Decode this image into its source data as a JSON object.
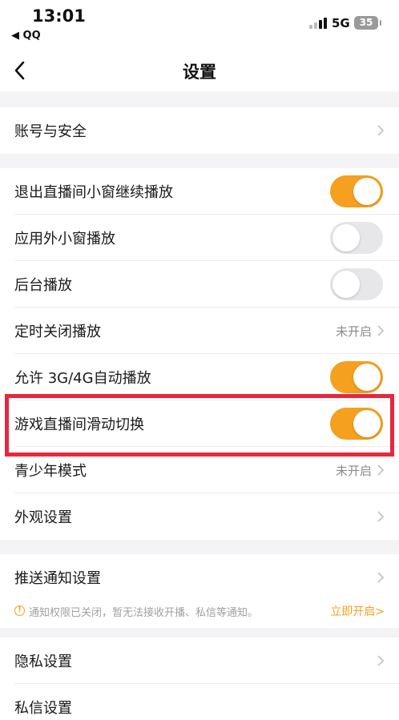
{
  "status_bar": {
    "time": "13:01",
    "back_app": "◀ QQ",
    "network": "5G",
    "battery": "35"
  },
  "nav": {
    "title": "设置"
  },
  "groups": {
    "account": {
      "label": "账号与安全"
    },
    "playback": [
      {
        "label": "退出直播间小窗继续播放",
        "toggle": true
      },
      {
        "label": "应用外小窗播放",
        "toggle": false
      },
      {
        "label": "后台播放",
        "toggle": false
      },
      {
        "label": "定时关闭播放",
        "value": "未开启"
      },
      {
        "label": "允许 3G/4G自动播放",
        "toggle": true
      },
      {
        "label": "游戏直播间滑动切换",
        "toggle": true
      },
      {
        "label": "青少年模式",
        "value": "未开启"
      },
      {
        "label": "外观设置"
      }
    ],
    "notify": {
      "label": "推送通知设置",
      "notice_text": "通知权限已关闭，暂无法接收开播、私信等通知。",
      "notice_action": "立即开启>"
    },
    "privacy": [
      {
        "label": "隐私设置"
      },
      {
        "label": "私信设置"
      }
    ]
  },
  "colors": {
    "accent": "#f5a01e",
    "highlight": "#e5283f"
  }
}
